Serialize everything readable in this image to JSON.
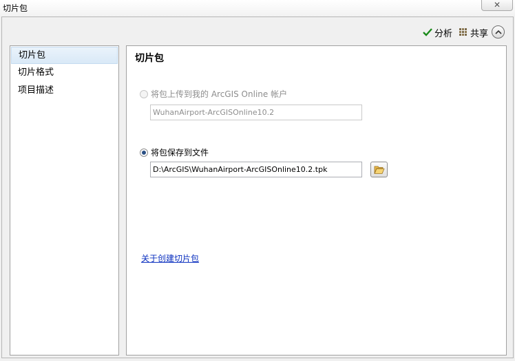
{
  "window": {
    "title": "切片包",
    "close_icon": "close-icon"
  },
  "toolbar": {
    "analyze_label": "分析",
    "analyze_icon": "checkmark-icon",
    "share_label": "共享",
    "share_icon": "share-grid-icon",
    "collapse_icon": "chevron-up-icon",
    "accent_color": "#1a8a1a"
  },
  "sidebar": {
    "items": [
      {
        "label": "切片包",
        "selected": true
      },
      {
        "label": "切片格式",
        "selected": false
      },
      {
        "label": "项目描述",
        "selected": false
      }
    ]
  },
  "main": {
    "title": "切片包",
    "option_upload": {
      "label": "将包上传到我的 ArcGIS Online 帐户",
      "checked": false,
      "enabled": false,
      "value": "WuhanAirport-ArcGISOnline10.2"
    },
    "option_save": {
      "label": "将包保存到文件",
      "checked": true,
      "enabled": true,
      "value": "D:\\ArcGIS\\WuhanAirport-ArcGISOnline10.2.tpk",
      "browse_icon": "folder-open-icon"
    },
    "help_link": "关于创建切片包",
    "link_color": "#0a2fbf"
  }
}
